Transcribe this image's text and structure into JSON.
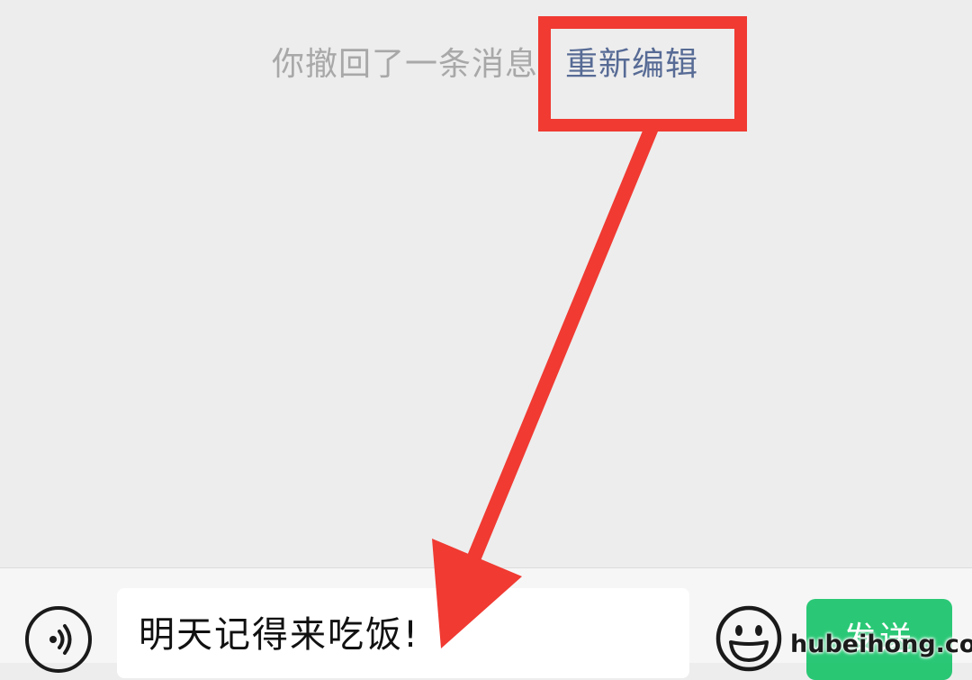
{
  "chat": {
    "recall_notice": "你撤回了一条消息",
    "reedit_label": "重新编辑"
  },
  "input_bar": {
    "message_value": "明天记得来吃饭!",
    "send_label": "发送"
  },
  "watermark": {
    "text": "hubeihong.com"
  },
  "colors": {
    "chat_background": "#ededed",
    "link_blue": "#576b95",
    "recall_gray": "#a8a8a8",
    "annotation_red": "#f03a32",
    "send_green": "#07c160"
  },
  "icons": {
    "voice": "voice-icon",
    "emoji": "emoji-icon"
  }
}
